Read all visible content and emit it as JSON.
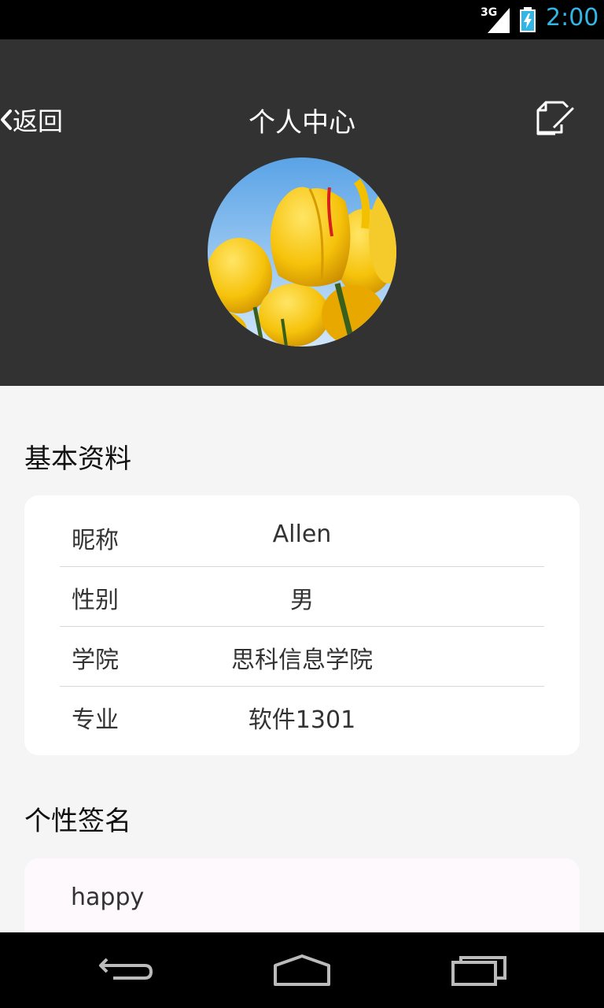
{
  "status_bar": {
    "network": "3G",
    "time": "2:00",
    "icons": [
      "signal-icon",
      "battery-charging-icon"
    ]
  },
  "header": {
    "back_label": "返回",
    "title": "个人中心",
    "edit_icon": "edit-icon"
  },
  "basic_info": {
    "section_title": "基本资料",
    "rows": [
      {
        "label": "昵称",
        "value": "Allen"
      },
      {
        "label": "性别",
        "value": "男"
      },
      {
        "label": "学院",
        "value": "思科信息学院"
      },
      {
        "label": "专业",
        "value": "软件1301"
      }
    ]
  },
  "signature": {
    "section_title": "个性签名",
    "text": "happy"
  },
  "nav_bar": {
    "icons": [
      "back-nav-icon",
      "home-icon",
      "recent-apps-icon"
    ]
  },
  "colors": {
    "header_bg": "#323232",
    "status_time": "#33b5e5",
    "page_bg": "#f5f5f5"
  }
}
